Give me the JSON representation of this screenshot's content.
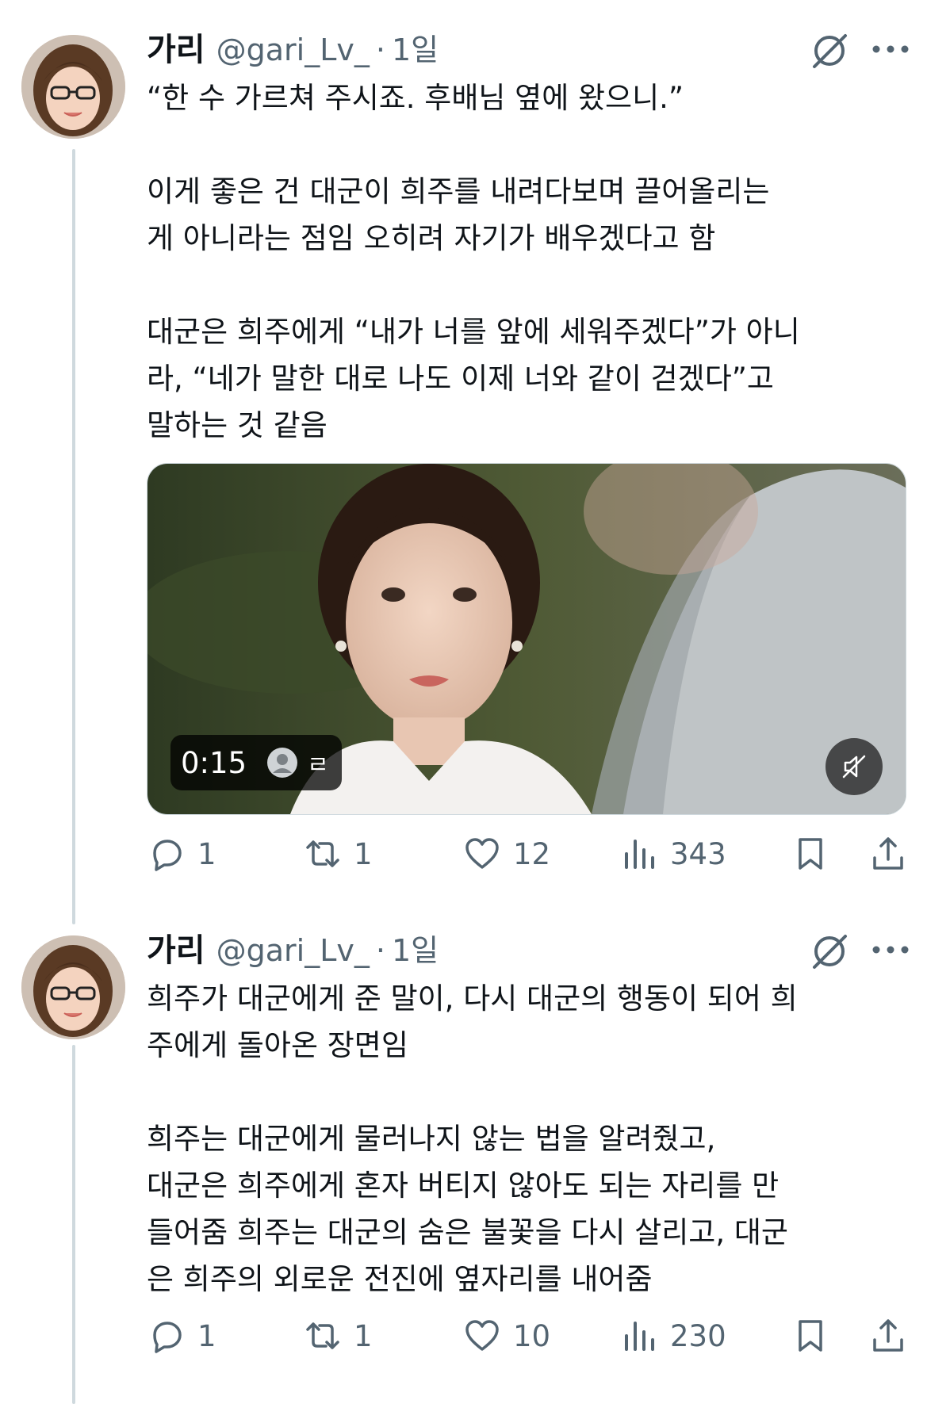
{
  "tweets": [
    {
      "author_name": "가리",
      "handle": "@gari_Lv_",
      "separator": "·",
      "time": "1일",
      "paragraphs": [
        "“한 수 가르쳐 주시죠. 후배님 옆에 왔으니.”",
        "이게 좋은 건 대군이 희주를 내려다보며 끌어올리는\n게 아니라는 점임 오히려 자기가 배우겠다고 함",
        "대군은 희주에게 “내가 너를 앞에 세워주겠다”가 아니\n라, “네가 말한 대로 나도 이제 너와 같이 걷겠다”고\n말하는 것 같음"
      ],
      "media": {
        "duration": "0:15",
        "badge_label": "ㄹ"
      },
      "stats": {
        "replies": "1",
        "reposts": "1",
        "likes": "12",
        "views": "343"
      }
    },
    {
      "author_name": "가리",
      "handle": "@gari_Lv_",
      "separator": "·",
      "time": "1일",
      "paragraphs": [
        "희주가 대군에게 준 말이, 다시 대군의 행동이 되어 희\n주에게 돌아온 장면임",
        "희주는 대군에게 물러나지 않는 법을 알려줬고,\n대군은 희주에게 혼자 버티지 않아도 되는 자리를 만\n들어줌 희주는 대군의 숨은 불꽃을 다시 살리고, 대군\n은 희주의 외로운 전진에 옆자리를 내어줌"
      ],
      "stats": {
        "replies": "1",
        "reposts": "1",
        "likes": "10",
        "views": "230"
      }
    }
  ],
  "icons": {
    "reply": "reply-icon",
    "repost": "repost-icon",
    "like": "heart-icon",
    "views": "views-chart-icon",
    "bookmark": "bookmark-icon",
    "share": "share-icon",
    "grok": "grok-icon",
    "more": "more-icon",
    "mute": "muted-speaker-icon"
  },
  "colors": {
    "text": "#0f1419",
    "secondary": "#536471",
    "thread_line": "#cfd9de"
  }
}
